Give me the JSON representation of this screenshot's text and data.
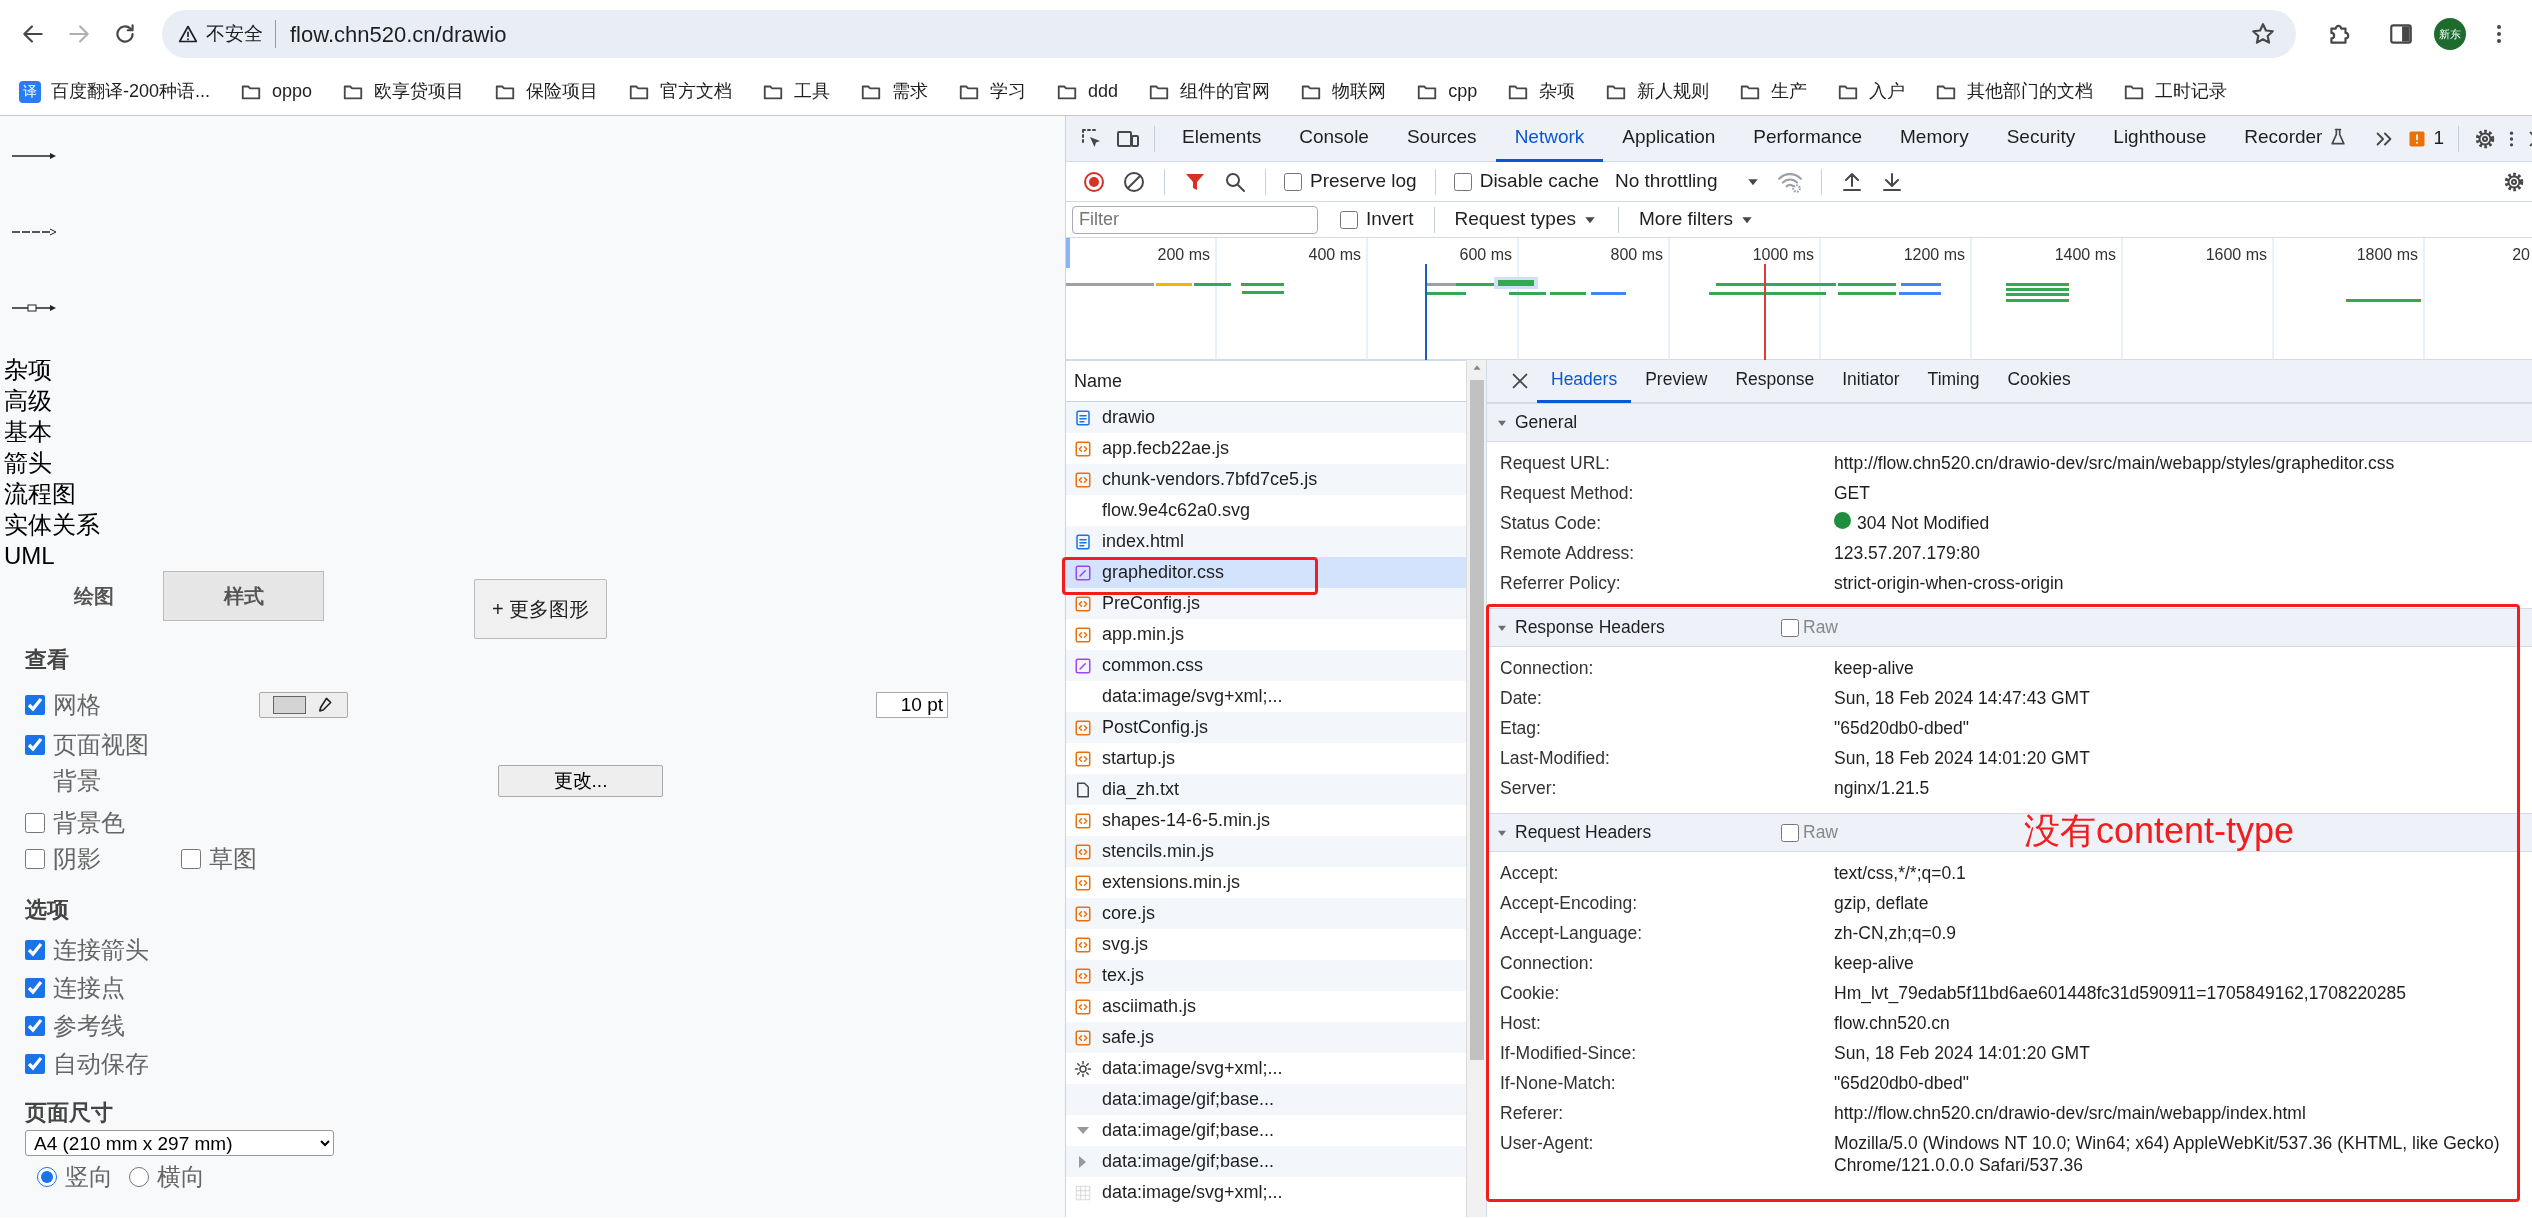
{
  "browser": {
    "security_label": "不安全",
    "url": "flow.chn520.cn/drawio",
    "profile": "新东"
  },
  "bookmarks": [
    {
      "label": "百度翻译-200种语...",
      "kind": "app",
      "badge": "译"
    },
    {
      "label": "oppo",
      "kind": "folder"
    },
    {
      "label": "欧享贷项目",
      "kind": "folder"
    },
    {
      "label": "保险项目",
      "kind": "folder"
    },
    {
      "label": "官方文档",
      "kind": "folder"
    },
    {
      "label": "工具",
      "kind": "folder"
    },
    {
      "label": "需求",
      "kind": "folder"
    },
    {
      "label": "学习",
      "kind": "folder"
    },
    {
      "label": "ddd",
      "kind": "folder"
    },
    {
      "label": "组件的官网",
      "kind": "folder"
    },
    {
      "label": "物联网",
      "kind": "folder"
    },
    {
      "label": "cpp",
      "kind": "folder"
    },
    {
      "label": "杂项",
      "kind": "folder"
    },
    {
      "label": "新人规则",
      "kind": "folder"
    },
    {
      "label": "生产",
      "kind": "folder"
    },
    {
      "label": "入户",
      "kind": "folder"
    },
    {
      "label": "其他部门的文档",
      "kind": "folder"
    },
    {
      "label": "工时记录",
      "kind": "folder"
    }
  ],
  "page": {
    "libraries": [
      "杂项",
      "高级",
      "基本",
      "箭头",
      "流程图",
      "实体关系",
      "UML"
    ],
    "tabs": [
      {
        "label": "绘图",
        "selected": true
      },
      {
        "label": "样式",
        "selected": false
      }
    ],
    "more_shapes": "+ 更多图形",
    "view": {
      "title": "查看",
      "grid": {
        "label": "网格",
        "checked": true
      },
      "grid_size": "10 pt",
      "page_view": {
        "label": "页面视图",
        "checked": true
      },
      "background": "背景",
      "change": "更改...",
      "background_color": {
        "label": "背景色",
        "checked": false
      },
      "shadow": {
        "label": "阴影",
        "checked": false
      },
      "sketch": {
        "label": "草图",
        "checked": false
      }
    },
    "options": {
      "title": "选项",
      "items": [
        {
          "label": "连接箭头",
          "checked": true
        },
        {
          "label": "连接点",
          "checked": true
        },
        {
          "label": "参考线",
          "checked": true
        },
        {
          "label": "自动保存",
          "checked": true
        }
      ]
    },
    "page_size": {
      "title": "页面尺寸",
      "value": "A4 (210 mm x 297 mm)",
      "orientations": [
        {
          "label": "竖向",
          "selected": true
        },
        {
          "label": "横向",
          "selected": false
        }
      ]
    }
  },
  "devtools": {
    "tabs": [
      {
        "label": "Elements",
        "selected": false
      },
      {
        "label": "Console",
        "selected": false
      },
      {
        "label": "Sources",
        "selected": false
      },
      {
        "label": "Network",
        "selected": true
      },
      {
        "label": "Application",
        "selected": false
      },
      {
        "label": "Performance",
        "selected": false
      },
      {
        "label": "Memory",
        "selected": false
      },
      {
        "label": "Security",
        "selected": false
      },
      {
        "label": "Lighthouse",
        "selected": false
      },
      {
        "label": "Recorder",
        "selected": false
      }
    ],
    "issues_count": "1",
    "toolbar": {
      "preserve_log": {
        "label": "Preserve log",
        "checked": false
      },
      "disable_cache": {
        "label": "Disable cache",
        "checked": false
      },
      "throttling": "No throttling"
    },
    "filter": {
      "placeholder": "Filter",
      "invert": {
        "label": "Invert",
        "checked": false
      },
      "request_types": "Request types",
      "more_filters": "More filters"
    },
    "timeline_ticks": [
      "200 ms",
      "400 ms",
      "600 ms",
      "800 ms",
      "1000 ms",
      "1200 ms",
      "1400 ms",
      "1600 ms",
      "1800 ms",
      "20"
    ],
    "requests": {
      "column": "Name",
      "rows": [
        {
          "name": "drawio",
          "kind": "doc",
          "selected": false
        },
        {
          "name": "app.fecb22ae.js",
          "kind": "script",
          "selected": false
        },
        {
          "name": "chunk-vendors.7bfd7ce5.js",
          "kind": "script",
          "selected": false
        },
        {
          "name": "flow.9e4c62a0.svg",
          "kind": "none",
          "selected": false
        },
        {
          "name": "index.html",
          "kind": "doc",
          "selected": false
        },
        {
          "name": "grapheditor.css",
          "kind": "stylesheet",
          "selected": true
        },
        {
          "name": "PreConfig.js",
          "kind": "script",
          "selected": false
        },
        {
          "name": "app.min.js",
          "kind": "script",
          "selected": false
        },
        {
          "name": "common.css",
          "kind": "stylesheet",
          "selected": false
        },
        {
          "name": "data:image/svg+xml;...",
          "kind": "none",
          "selected": false
        },
        {
          "name": "PostConfig.js",
          "kind": "script",
          "selected": false
        },
        {
          "name": "startup.js",
          "kind": "script",
          "selected": false
        },
        {
          "name": "dia_zh.txt",
          "kind": "text",
          "selected": false
        },
        {
          "name": "shapes-14-6-5.min.js",
          "kind": "script",
          "selected": false
        },
        {
          "name": "stencils.min.js",
          "kind": "script",
          "selected": false
        },
        {
          "name": "extensions.min.js",
          "kind": "script",
          "selected": false
        },
        {
          "name": "core.js",
          "kind": "script",
          "selected": false
        },
        {
          "name": "svg.js",
          "kind": "script",
          "selected": false
        },
        {
          "name": "tex.js",
          "kind": "script",
          "selected": false
        },
        {
          "name": "asciimath.js",
          "kind": "script",
          "selected": false
        },
        {
          "name": "safe.js",
          "kind": "script",
          "selected": false
        },
        {
          "name": "data:image/svg+xml;...",
          "kind": "sun",
          "selected": false
        },
        {
          "name": "data:image/gif;base...",
          "kind": "none",
          "selected": false
        },
        {
          "name": "data:image/gif;base...",
          "kind": "caret-down",
          "selected": false
        },
        {
          "name": "data:image/gif;base...",
          "kind": "caret-right",
          "selected": false
        },
        {
          "name": "data:image/svg+xml;...",
          "kind": "grid",
          "selected": false
        }
      ]
    },
    "details": {
      "tabs": [
        {
          "label": "Headers",
          "selected": true
        },
        {
          "label": "Preview",
          "selected": false
        },
        {
          "label": "Response",
          "selected": false
        },
        {
          "label": "Initiator",
          "selected": false
        },
        {
          "label": "Timing",
          "selected": false
        },
        {
          "label": "Cookies",
          "selected": false
        }
      ],
      "sections": [
        {
          "title": "General",
          "rows": [
            {
              "name": "Request URL:",
              "value": "http://flow.chn520.cn/drawio-dev/src/main/webapp/styles/grapheditor.css"
            },
            {
              "name": "Request Method:",
              "value": "GET"
            },
            {
              "name": "Status Code:",
              "value": "304 Not Modified",
              "color": "#1e8e3e"
            },
            {
              "name": "Remote Address:",
              "value": "123.57.207.179:80"
            },
            {
              "name": "Referrer Policy:",
              "value": "strict-origin-when-cross-origin"
            }
          ]
        },
        {
          "title": "Response Headers",
          "raw": {
            "label": "Raw",
            "checked": false
          },
          "rows": [
            {
              "name": "Connection:",
              "value": "keep-alive"
            },
            {
              "name": "Date:",
              "value": "Sun, 18 Feb 2024 14:47:43 GMT"
            },
            {
              "name": "Etag:",
              "value": "\"65d20db0-dbed\""
            },
            {
              "name": "Last-Modified:",
              "value": "Sun, 18 Feb 2024 14:01:20 GMT"
            },
            {
              "name": "Server:",
              "value": "nginx/1.21.5"
            }
          ]
        },
        {
          "title": "Request Headers",
          "raw": {
            "label": "Raw",
            "checked": false
          },
          "rows": [
            {
              "name": "Accept:",
              "value": "text/css,*/*;q=0.1"
            },
            {
              "name": "Accept-Encoding:",
              "value": "gzip, deflate"
            },
            {
              "name": "Accept-Language:",
              "value": "zh-CN,zh;q=0.9"
            },
            {
              "name": "Connection:",
              "value": "keep-alive"
            },
            {
              "name": "Cookie:",
              "value": "Hm_lvt_79edab5f11bd6ae601448fc31d590911=1705849162,1708220285"
            },
            {
              "name": "Host:",
              "value": "flow.chn520.cn"
            },
            {
              "name": "If-Modified-Since:",
              "value": "Sun, 18 Feb 2024 14:01:20 GMT"
            },
            {
              "name": "If-None-Match:",
              "value": "\"65d20db0-dbed\""
            },
            {
              "name": "Referer:",
              "value": "http://flow.chn520.cn/drawio-dev/src/main/webapp/index.html"
            },
            {
              "name": "User-Agent:",
              "value": "Mozilla/5.0 (Windows NT 10.0; Win64; x64) AppleWebKit/537.36 (KHTML, like Gecko) Chrome/121.0.0.0 Safari/537.36"
            }
          ]
        }
      ]
    }
  },
  "annotation": {
    "note": "没有content-type"
  }
}
